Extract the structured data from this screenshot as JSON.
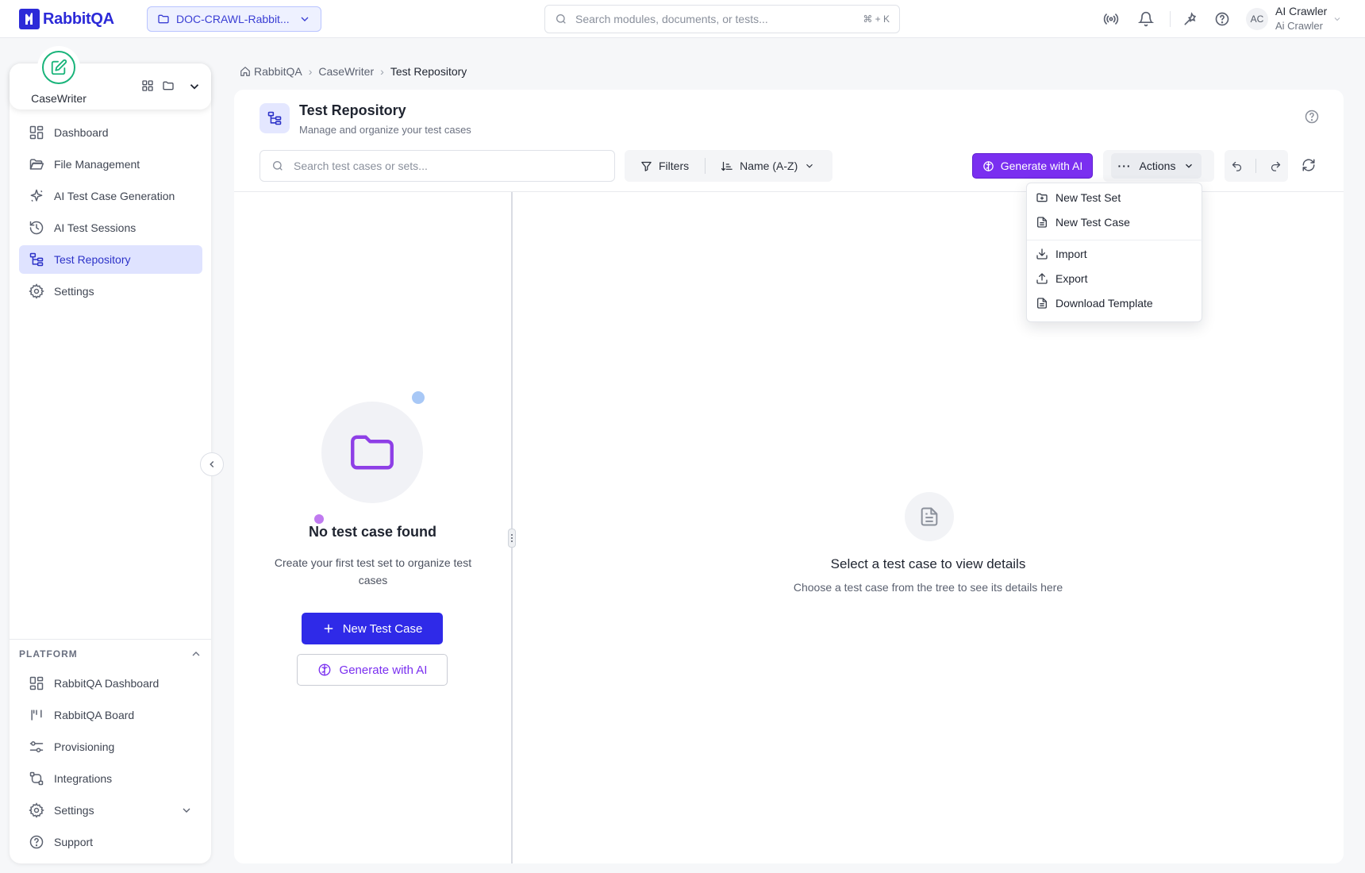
{
  "app": {
    "brand": "RabbitQA",
    "project": "DOC-CRAWL-Rabbit...",
    "search_placeholder": "Search modules, documents, or tests...",
    "search_shortcut": "⌘ + K"
  },
  "user": {
    "initials": "AC",
    "name": "AI Crawler",
    "role": "Ai Crawler"
  },
  "sidebar": {
    "app_name": "CaseWriter",
    "items": [
      {
        "label": "Dashboard",
        "icon": "grid-icon"
      },
      {
        "label": "File Management",
        "icon": "folder-icon"
      },
      {
        "label": "AI Test Case Generation",
        "icon": "sparkle-icon"
      },
      {
        "label": "AI Test Sessions",
        "icon": "history-icon"
      },
      {
        "label": "Test Repository",
        "icon": "tree-icon",
        "active": true
      },
      {
        "label": "Settings",
        "icon": "gear-icon"
      }
    ],
    "platform_title": "PLATFORM",
    "platform_items": [
      {
        "label": "RabbitQA Dashboard",
        "icon": "grid-icon"
      },
      {
        "label": "RabbitQA Board",
        "icon": "board-icon"
      },
      {
        "label": "Provisioning",
        "icon": "sliders-icon"
      },
      {
        "label": "Integrations",
        "icon": "integrations-icon"
      },
      {
        "label": "Settings",
        "icon": "gear-icon"
      },
      {
        "label": "Support",
        "icon": "help-icon"
      }
    ]
  },
  "breadcrumb": {
    "home": "RabbitQA",
    "parent": "CaseWriter",
    "current": "Test Repository"
  },
  "page": {
    "title": "Test Repository",
    "subtitle": "Manage and organize your test cases"
  },
  "toolbar": {
    "search_placeholder": "Search test cases or sets...",
    "filters_label": "Filters",
    "sort_label": "Name (A-Z)",
    "generate_label": "Generate with AI",
    "actions_label": "Actions"
  },
  "actions_menu": [
    {
      "label": "New Test Set",
      "icon": "folder-plus-icon"
    },
    {
      "label": "New Test Case",
      "icon": "file-text-icon"
    },
    {
      "label": "Import",
      "icon": "download-icon"
    },
    {
      "label": "Export",
      "icon": "upload-icon"
    },
    {
      "label": "Download Template",
      "icon": "file-text-icon"
    }
  ],
  "empty_tree": {
    "title": "No test case found",
    "description": "Create your first test set to organize test cases",
    "new_button": "New Test Case",
    "generate_button": "Generate with AI"
  },
  "detail_empty": {
    "title": "Select a test case to view details",
    "description": "Choose a test case from the tree to see its details here"
  },
  "colors": {
    "brand": "#2c2ad8",
    "ai_purple": "#7a2ff0",
    "primary_button": "#2f2ae8",
    "active_nav": "#dfe3ff",
    "success": "#19b47a"
  }
}
